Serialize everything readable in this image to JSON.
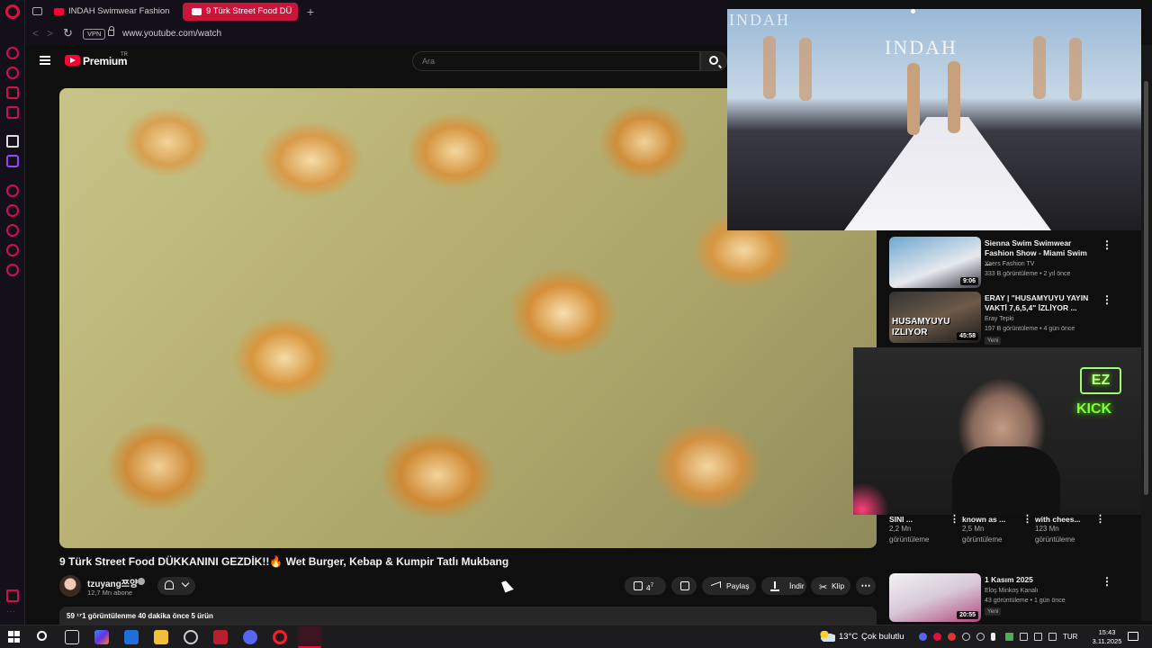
{
  "browser": {
    "tabs": [
      {
        "label": "INDAH Swimwear Fashion"
      },
      {
        "label": "9 Türk Street Food DÜ"
      }
    ],
    "new_tab": "+",
    "vpn": "VPN",
    "url": "www.youtube.com/watch"
  },
  "youtube": {
    "logo": "Premium",
    "region": "TR",
    "search_placeholder": "Ara",
    "pip_brand": "INDAH",
    "video": {
      "title": "9 Türk Street Food DÜKKANINI GEZDİK!!🔥 Wet Burger, Kebap & Kumpir Tatlı Mukbang",
      "channel": "tzuyang쯔양",
      "subscribers": "12,7 Mn abone",
      "likes": "4",
      "likes_sup": "7",
      "share": "Paylaş",
      "download": "İndir",
      "clip": "Klip",
      "more": "⋯",
      "description": "59 ¹⁷1 görüntülenme  40 dakika önce  5 ürün"
    },
    "recommendations": [
      {
        "title": "Sienna Swim Swimwear Fashion Show - Miami Swim ...",
        "channel": "Yaers Fashion TV",
        "meta": "333 B görüntüleme • 2 yıl önce",
        "duration": "9:06",
        "new": ""
      },
      {
        "title": "ERAY | \"HUSAMYUYU YAYIN VAKTİ 7,6,5,4\" İZLİYOR ...",
        "channel": "Eray Tepki",
        "meta": "197 B görüntüleme • 4 gün önce",
        "duration": "45:58",
        "new": "Yeni"
      },
      {
        "title": "1 Kasım 2025",
        "channel": "Eloş Minkoş Kanalı",
        "meta": "43 görüntüleme • 1 gün önce",
        "duration": "20:55",
        "new": "Yeni"
      }
    ],
    "thumb_overlay": "HUSAMYUYU IZLIYOR",
    "mini": [
      {
        "title": "SINI ...",
        "views": "2,2 Mn",
        "label": "görüntüleme"
      },
      {
        "title": "known as ...",
        "views": "2,5 Mn",
        "label": "görüntüleme"
      },
      {
        "title": "with chees...",
        "views": "123 Mn",
        "label": "görüntüleme"
      }
    ]
  },
  "stream_overlay": {
    "logo": "EZ",
    "platform": "KICK"
  },
  "taskbar": {
    "temperature": "13°C",
    "weather": "Çok bulutlu",
    "language": "TUR",
    "time": "15:43",
    "date": "3.11.2025"
  },
  "colors": {
    "accent": "#ff0033",
    "opera": "#e0103c",
    "active_tab": "#c8163a"
  }
}
